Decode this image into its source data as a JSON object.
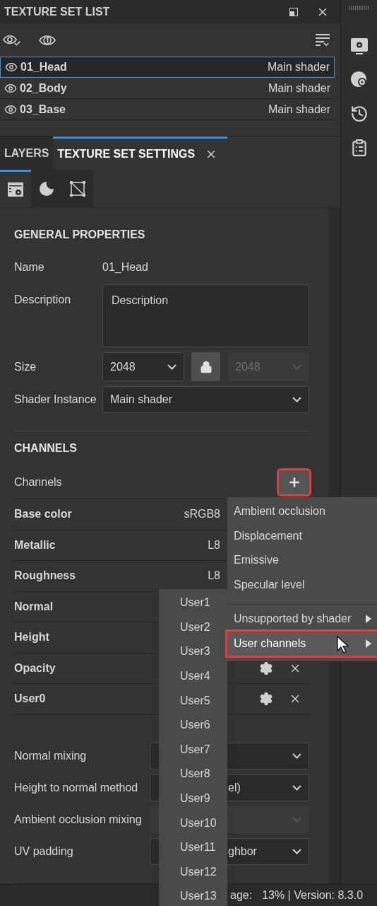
{
  "texture_set_list": {
    "title": "TEXTURE SET LIST",
    "items": [
      {
        "name": "01_Head",
        "shader": "Main shader",
        "selected": true
      },
      {
        "name": "02_Body",
        "shader": "Main shader",
        "selected": false
      },
      {
        "name": "03_Base",
        "shader": "Main shader",
        "selected": false
      }
    ]
  },
  "tabs": [
    {
      "label": "LAYERS",
      "selected": false,
      "closable": false
    },
    {
      "label": "TEXTURE SET SETTINGS",
      "selected": true,
      "closable": true
    }
  ],
  "subtabs": [
    {
      "kind": "settings",
      "selected": true
    },
    {
      "kind": "material",
      "selected": false
    },
    {
      "kind": "mesh",
      "selected": false
    }
  ],
  "general": {
    "title": "GENERAL PROPERTIES",
    "name_label": "Name",
    "name_value": "01_Head",
    "description_label": "Description",
    "description_value": "Description",
    "size_label": "Size",
    "size_value": "2048",
    "size_second": {
      "value": "2048",
      "disabled": true
    },
    "shader_label": "Shader Instance",
    "shader_value": "Main shader"
  },
  "channels": {
    "title": "CHANNELS",
    "label": "Channels",
    "add_highlighted": true,
    "items": [
      {
        "name": "Base color",
        "format": "sRGB8"
      },
      {
        "name": "Metallic",
        "format": "L8"
      },
      {
        "name": "Roughness",
        "format": "L8"
      },
      {
        "name": "Normal"
      },
      {
        "name": "Height"
      },
      {
        "name": "Opacity",
        "actions": true
      },
      {
        "name": "User0",
        "actions": true
      }
    ]
  },
  "options": [
    {
      "label": "Normal mixing",
      "disabled": false
    },
    {
      "label": "Height to normal method",
      "value_end": "el)",
      "disabled": false
    },
    {
      "label": "Ambient occlusion mixing",
      "disabled": true
    },
    {
      "label": "UV padding",
      "value_end": "ghbor",
      "disabled": false
    }
  ],
  "add_menu": {
    "items": [
      {
        "label": "Ambient occlusion",
        "kind": "item",
        "highlighted": false
      },
      {
        "label": "Displacement",
        "kind": "item",
        "highlighted": false
      },
      {
        "label": "Emissive",
        "kind": "item",
        "highlighted": false
      },
      {
        "label": "Specular level",
        "kind": "item",
        "highlighted": false
      },
      {
        "label": "Unsupported by shader",
        "kind": "submenu",
        "highlighted": false
      },
      {
        "label": "User channels",
        "kind": "submenu",
        "highlighted": true
      }
    ]
  },
  "user_channels_menu": [
    "User1",
    "User2",
    "User3",
    "User4",
    "User5",
    "User6",
    "User7",
    "User8",
    "User9",
    "User10",
    "User11",
    "User12",
    "User13"
  ],
  "status_bar": {
    "parts": [
      "age:",
      "13% | Version: 8.3.0"
    ]
  }
}
